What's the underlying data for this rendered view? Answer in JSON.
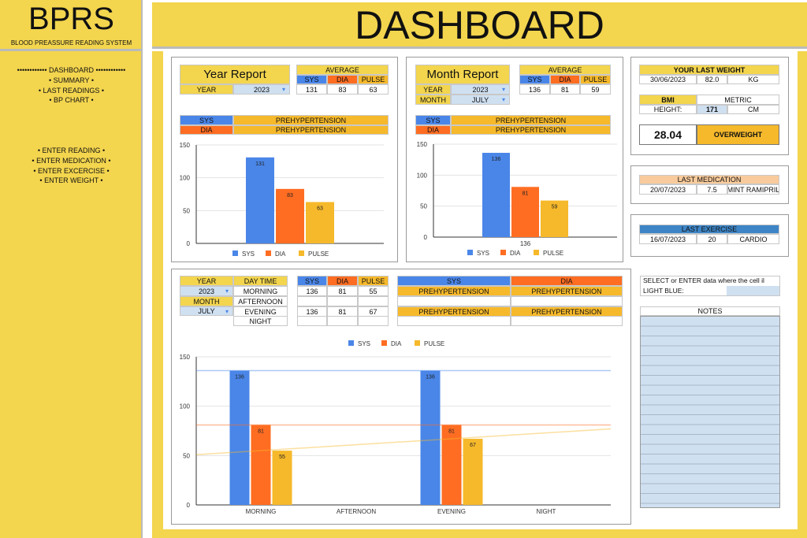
{
  "app": {
    "title": "BPRS",
    "subtitle": "BLOOD PREASSURE READING SYSTEM",
    "header": "DASHBOARD"
  },
  "menu": {
    "items": [
      "•••••••••••• DASHBOARD ••••••••••••",
      "• SUMMARY •",
      "• LAST READINGS •",
      "• BP CHART •"
    ],
    "entry_items": [
      "• ENTER READING •",
      "• ENTER MEDICATION •",
      "• ENTER EXCERCISE •",
      "• ENTER WEIGHT •"
    ]
  },
  "year_report": {
    "title": "Year Report",
    "year_label": "YEAR",
    "year": "2023",
    "average_label": "AVERAGE",
    "sys_label": "SYS",
    "dia_label": "DIA",
    "pulse_label": "PULSE",
    "sys": "131",
    "dia": "83",
    "pulse": "63",
    "sys_class": "PREHYPERTENSION",
    "dia_class": "PREHYPERTENSION"
  },
  "month_report": {
    "title": "Month Report",
    "year_label": "YEAR",
    "year": "2023",
    "month_label": "MONTH",
    "month": "JULY",
    "average_label": "AVERAGE",
    "sys_label": "SYS",
    "dia_label": "DIA",
    "pulse_label": "PULSE",
    "sys": "136",
    "dia": "81",
    "pulse": "59",
    "sys_class": "PREHYPERTENSION",
    "dia_class": "PREHYPERTENSION"
  },
  "weight": {
    "header": "YOUR LAST WEIGHT",
    "date": "30/06/2023",
    "value": "82.0",
    "unit": "KG",
    "bmi_label": "BMI",
    "system": "METRIC",
    "height_label": "HEIGHT:",
    "height": "171",
    "height_unit": "CM",
    "bmi": "28.04",
    "bmi_class": "OVERWEIGHT"
  },
  "medication": {
    "header": "LAST MEDICATION",
    "date": "20/07/2023",
    "dose": "7.5",
    "name": "MINT RAMIPRIL"
  },
  "exercise": {
    "header": "LAST EXERCISE",
    "date": "16/07/2023",
    "duration": "20",
    "type": "CARDIO"
  },
  "daily": {
    "year_label": "YEAR",
    "year": "2023",
    "month_label": "MONTH",
    "month": "JULY",
    "daytime_label": "DAY TIME",
    "sys_label": "SYS",
    "dia_label": "DIA",
    "pulse_label": "PULSE",
    "rows": [
      {
        "time": "MORNING",
        "sys": "136",
        "dia": "81",
        "pulse": "55",
        "sys_class": "PREHYPERTENSION",
        "dia_class": "PREHYPERTENSION"
      },
      {
        "time": "AFTERNOON",
        "sys": "",
        "dia": "",
        "pulse": "",
        "sys_class": "",
        "dia_class": ""
      },
      {
        "time": "EVENING",
        "sys": "136",
        "dia": "81",
        "pulse": "67",
        "sys_class": "PREHYPERTENSION",
        "dia_class": "PREHYPERTENSION"
      },
      {
        "time": "NIGHT",
        "sys": "",
        "dia": "",
        "pulse": "",
        "sys_class": "",
        "dia_class": ""
      }
    ]
  },
  "hint": "SELECT or ENTER data where the cell il LIGHT BLUE:",
  "notes_label": "NOTES",
  "colors": {
    "sys": "#4a86e8",
    "dia": "#ff6d22",
    "pulse": "#f6b92b",
    "yellow": "#f3d54e",
    "light_blue": "#cfe0f1"
  },
  "chart_data": [
    {
      "type": "bar",
      "categories": [
        ""
      ],
      "series": [
        {
          "name": "SYS",
          "values": [
            131
          ]
        },
        {
          "name": "DIA",
          "values": [
            83
          ]
        },
        {
          "name": "PULSE",
          "values": [
            63
          ]
        }
      ],
      "ylim": [
        0,
        150
      ],
      "yticks": [
        "0",
        "50",
        "100",
        "150"
      ],
      "legend": "bottom",
      "data_labels": true
    },
    {
      "type": "bar",
      "categories": [
        "136"
      ],
      "series": [
        {
          "name": "SYS",
          "values": [
            136
          ]
        },
        {
          "name": "DIA",
          "values": [
            81
          ]
        },
        {
          "name": "PULSE",
          "values": [
            59
          ]
        }
      ],
      "ylim": [
        0,
        150
      ],
      "yticks": [
        "0",
        "50",
        "100",
        "150"
      ],
      "legend": "bottom",
      "data_labels": true
    },
    {
      "type": "bar",
      "categories": [
        "MORNING",
        "AFTERNOON",
        "EVENING",
        "NIGHT"
      ],
      "series": [
        {
          "name": "SYS",
          "values": [
            136,
            null,
            136,
            null
          ]
        },
        {
          "name": "DIA",
          "values": [
            81,
            null,
            81,
            null
          ]
        },
        {
          "name": "PULSE",
          "values": [
            55,
            null,
            67,
            null
          ]
        }
      ],
      "ylim": [
        0,
        150
      ],
      "yticks": [
        "0",
        "50",
        "100",
        "150"
      ],
      "legend": "top",
      "data_labels": true,
      "trendlines": true
    }
  ]
}
